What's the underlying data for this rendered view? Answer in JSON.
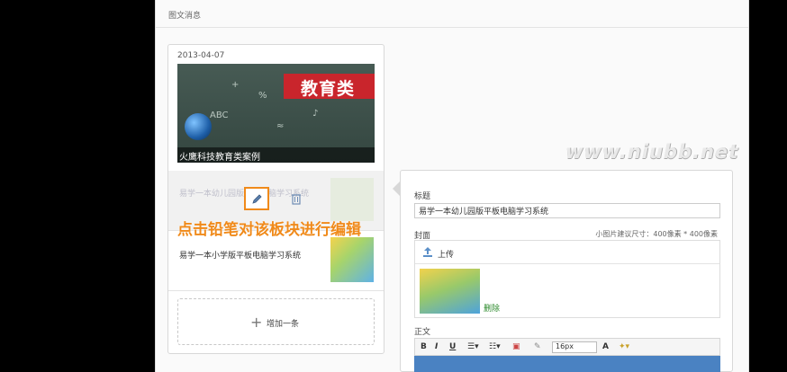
{
  "panel": {
    "title": "图文消息"
  },
  "news_card": {
    "date": "2013-04-07",
    "cover": {
      "banner_text": "教育类",
      "caption": "火鹰科技教育类案例",
      "doodles": [
        "ABC",
        "%",
        "+",
        "♪",
        "≈"
      ]
    },
    "items": [
      {
        "title": "易学一本幼儿园版平板电脑学习系统",
        "state": "active"
      },
      {
        "title": "易学一本小学版平板电脑学习系统",
        "state": "normal"
      }
    ],
    "add_label": "增加一条",
    "instruction": "点击铅笔对该板块进行编辑"
  },
  "watermark": "www.niubb.net",
  "editor": {
    "title_label": "标题",
    "title_value": "易学一本幼儿园版平板电脑学习系统",
    "cover_label": "封面",
    "cover_hint": "小图片建议尺寸：400像素 * 400像素",
    "upload_label": "上传",
    "delete_label": "删除",
    "body_label": "正文",
    "toolbar": {
      "bold": "B",
      "italic": "I",
      "underline": "U",
      "font_size": "16px",
      "font_color": "A"
    }
  },
  "colors": {
    "accent_orange": "#f08a1a",
    "banner_red": "#c9252c",
    "delete_green": "#2c8a2c"
  }
}
